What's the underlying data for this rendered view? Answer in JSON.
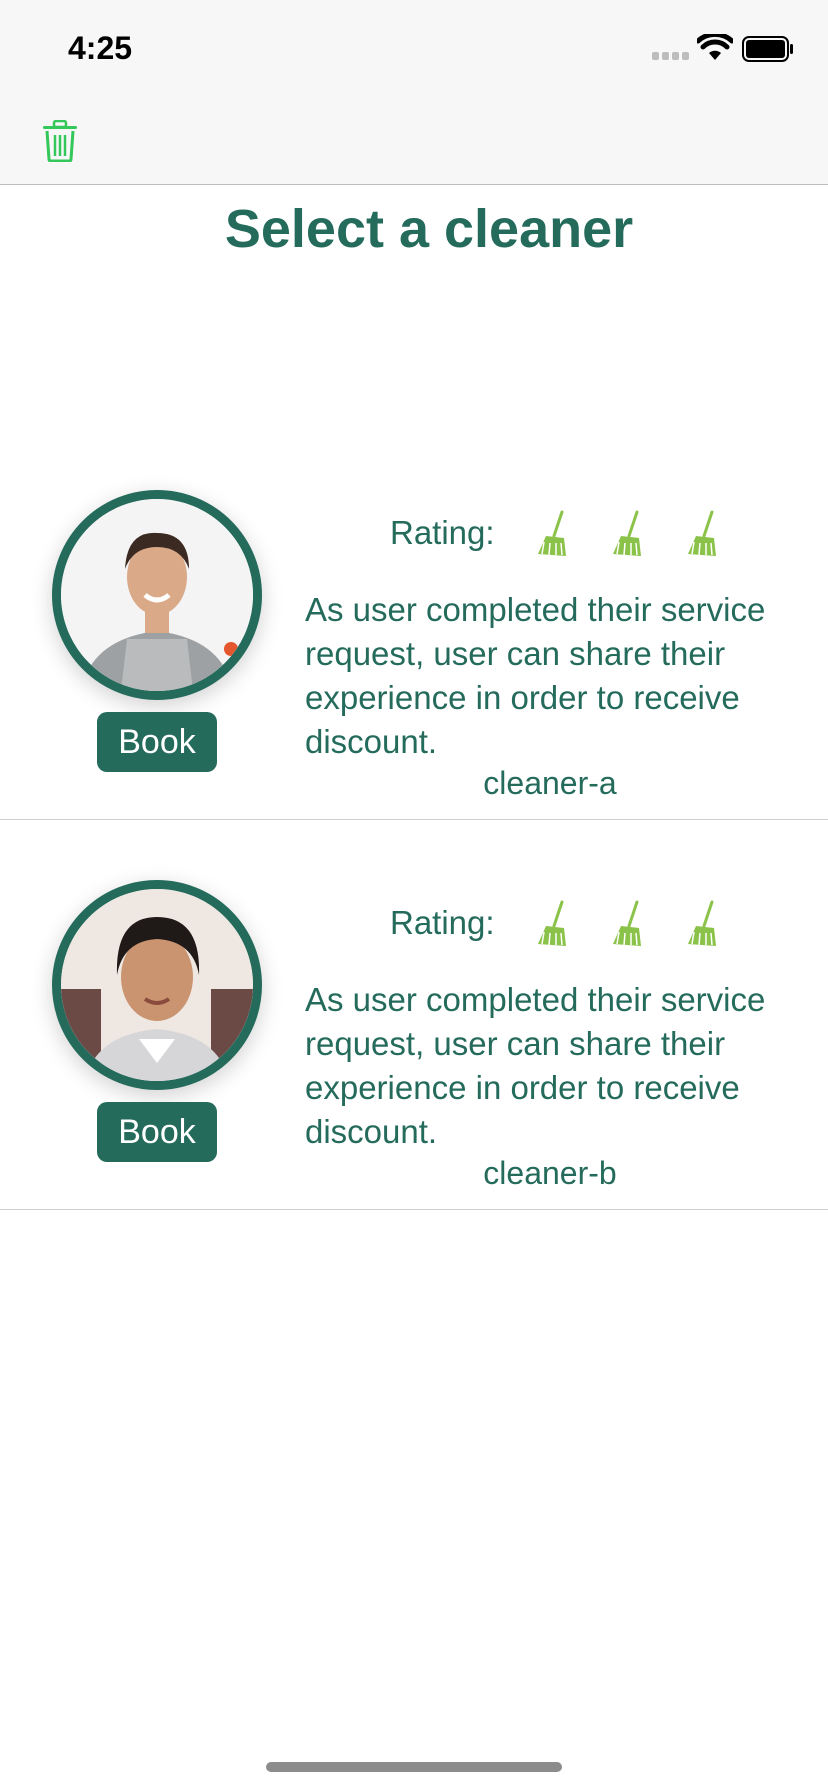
{
  "status_bar": {
    "time": "4:25"
  },
  "nav": {
    "trash_icon": "trash-icon"
  },
  "page": {
    "title": "Select a cleaner"
  },
  "cleaners": [
    {
      "name": "cleaner-a",
      "book_label": "Book",
      "rating_label": "Rating:",
      "rating_icons": 3,
      "rating_icon": "broom-icon",
      "description": "As user completed their service request, user  can share their experience in order to receive discount."
    },
    {
      "name": "cleaner-b",
      "book_label": "Book",
      "rating_label": "Rating:",
      "rating_icons": 3,
      "rating_icon": "broom-icon",
      "description": "As user completed their service request, user  can share their experience in order to receive discount."
    }
  ],
  "colors": {
    "brand": "#246b5c",
    "accent_green": "#34c759",
    "broom": "#8bc34a"
  }
}
